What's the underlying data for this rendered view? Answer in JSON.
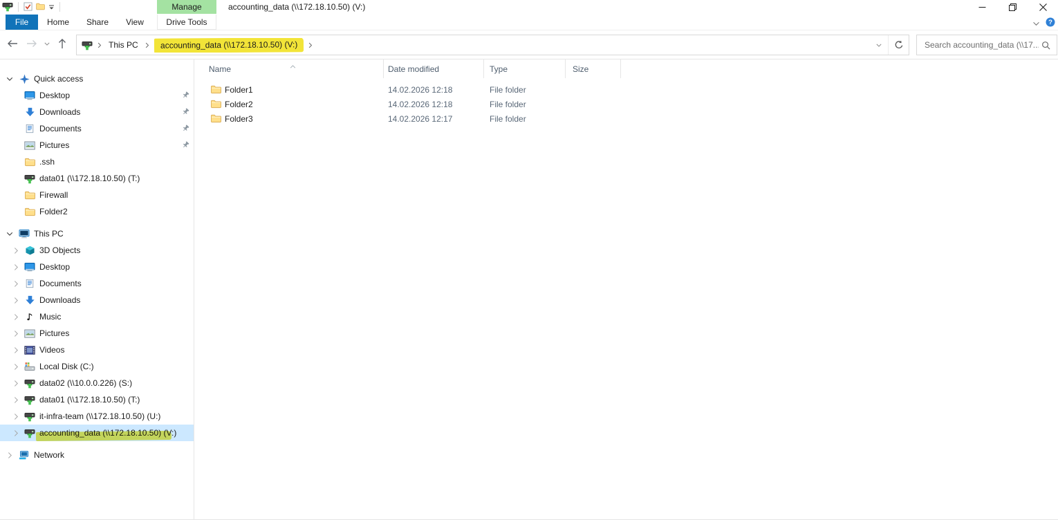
{
  "titlebar": {
    "title": "accounting_data (\\\\172.18.10.50) (V:)",
    "contextual_group": "Manage",
    "qat": [
      "drive-window-icon",
      "properties-icon",
      "new-folder-icon",
      "qat-dropdown-icon"
    ],
    "window_controls": [
      "minimize",
      "restore",
      "close"
    ]
  },
  "ribbon": {
    "tabs": [
      {
        "label": "File",
        "kind": "file"
      },
      {
        "label": "Home",
        "kind": "normal"
      },
      {
        "label": "Share",
        "kind": "normal"
      },
      {
        "label": "View",
        "kind": "normal"
      },
      {
        "label": "Drive Tools",
        "kind": "tool"
      }
    ],
    "right_icons": [
      "chevron-down-icon",
      "help-icon"
    ]
  },
  "navbar": {
    "back": "back-arrow-icon",
    "forward": "forward-arrow-icon",
    "recent_dropdown": "chevron-down-icon",
    "up": "up-arrow-icon",
    "breadcrumb_root_icon": "network-drive-icon",
    "breadcrumb": [
      {
        "label": "This PC",
        "highlighted": false
      },
      {
        "label": "accounting_data (\\\\172.18.10.50) (V:)",
        "highlighted": true
      }
    ],
    "address_dropdown": "chevron-down-icon",
    "refresh": "refresh-icon",
    "search_placeholder": "Search accounting_data (\\\\17..."
  },
  "sidebar": {
    "sections": [
      {
        "label": "Quick access",
        "icon": "quick-access-icon",
        "chevron": "expanded",
        "items": [
          {
            "label": "Desktop",
            "icon": "desktop-icon",
            "pinned": true
          },
          {
            "label": "Downloads",
            "icon": "downloads-icon",
            "pinned": true
          },
          {
            "label": "Documents",
            "icon": "documents-icon",
            "pinned": true
          },
          {
            "label": "Pictures",
            "icon": "pictures-icon",
            "pinned": true
          },
          {
            "label": ".ssh",
            "icon": "folder-icon"
          },
          {
            "label": "data01 (\\\\172.18.10.50) (T:)",
            "icon": "network-drive-icon"
          },
          {
            "label": "Firewall",
            "icon": "folder-icon"
          },
          {
            "label": "Folder2",
            "icon": "folder-icon"
          }
        ]
      },
      {
        "label": "This PC",
        "icon": "this-pc-icon",
        "chevron": "expanded",
        "items": [
          {
            "label": "3D Objects",
            "icon": "objects-3d-icon",
            "chevron": "collapsed"
          },
          {
            "label": "Desktop",
            "icon": "desktop-icon",
            "chevron": "collapsed"
          },
          {
            "label": "Documents",
            "icon": "documents-icon",
            "chevron": "collapsed"
          },
          {
            "label": "Downloads",
            "icon": "downloads-icon",
            "chevron": "collapsed"
          },
          {
            "label": "Music",
            "icon": "music-icon",
            "chevron": "collapsed"
          },
          {
            "label": "Pictures",
            "icon": "pictures-icon",
            "chevron": "collapsed"
          },
          {
            "label": "Videos",
            "icon": "videos-icon",
            "chevron": "collapsed"
          },
          {
            "label": "Local Disk (C:)",
            "icon": "local-disk-icon",
            "chevron": "collapsed"
          },
          {
            "label": "data02 (\\\\10.0.0.226) (S:)",
            "icon": "network-drive-icon",
            "chevron": "collapsed"
          },
          {
            "label": "data01 (\\\\172.18.10.50) (T:)",
            "icon": "network-drive-icon",
            "chevron": "collapsed"
          },
          {
            "label": "it-infra-team (\\\\172.18.10.50) (U:)",
            "icon": "network-drive-icon",
            "chevron": "collapsed"
          },
          {
            "label": "accounting_data (\\\\172.18.10.50) (V:)",
            "icon": "network-drive-icon",
            "chevron": "collapsed",
            "selected": true,
            "highlighted": true
          }
        ]
      },
      {
        "label": "Network",
        "icon": "network-icon",
        "chevron": "collapsed",
        "items": []
      }
    ]
  },
  "file_list": {
    "columns": [
      {
        "label": "Name",
        "sorted": "asc"
      },
      {
        "label": "Date modified"
      },
      {
        "label": "Type"
      },
      {
        "label": "Size"
      }
    ],
    "rows": [
      {
        "name": "Folder1",
        "icon": "folder-icon",
        "date_modified": "14.02.2026 12:18",
        "type": "File folder",
        "size": ""
      },
      {
        "name": "Folder2",
        "icon": "folder-icon",
        "date_modified": "14.02.2026 12:18",
        "type": "File folder",
        "size": ""
      },
      {
        "name": "Folder3",
        "icon": "folder-icon",
        "date_modified": "14.02.2026 12:17",
        "type": "File folder",
        "size": ""
      }
    ]
  },
  "icons": {
    "search-icon": "magnifier glyph",
    "refresh-icon": "circular arrow",
    "help-icon": "blue circle with ?",
    "pin-icon": "gray pushpin",
    "folder-icon": "yellow folder",
    "network-drive-icon": "gray drive with green stand",
    "chevron-down-icon": "v chevron",
    "chevron-right-icon": "> chevron"
  },
  "colors": {
    "file_tab_blue": "#1173b9",
    "manage_green": "#a4e2a2",
    "selection_blue": "#cce8ff",
    "highlighter_yellow": "#f2e438",
    "column_header_text": "#4e5d6d"
  }
}
